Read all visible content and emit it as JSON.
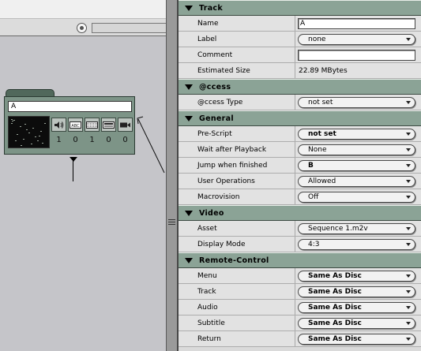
{
  "canvas": {
    "track_tile": {
      "name": "A",
      "stream_buttons": [
        {
          "icon": "speaker-icon",
          "count": "1"
        },
        {
          "icon": "abc-subtitle-icon",
          "count": "0"
        },
        {
          "icon": "menu-grid-icon",
          "count": "1"
        },
        {
          "icon": "marker-icon",
          "count": "0"
        },
        {
          "icon": "video-camera-icon",
          "count": "0"
        }
      ]
    }
  },
  "inspector": {
    "sections": [
      {
        "title": "Track",
        "rows": [
          {
            "label": "Name",
            "type": "text",
            "value": "A"
          },
          {
            "label": "Label",
            "type": "popup",
            "value": "none",
            "bold": false
          },
          {
            "label": "Comment",
            "type": "text",
            "value": ""
          },
          {
            "label": "Estimated Size",
            "type": "static",
            "value": "22.89 MBytes"
          }
        ]
      },
      {
        "title": "@ccess",
        "rows": [
          {
            "label": "@ccess Type",
            "type": "popup",
            "value": "not set",
            "bold": false
          }
        ]
      },
      {
        "title": "General",
        "rows": [
          {
            "label": "Pre-Script",
            "type": "popup",
            "value": "not set",
            "bold": true
          },
          {
            "label": "Wait after Playback",
            "type": "popup",
            "value": "None",
            "bold": false
          },
          {
            "label": "Jump when finished",
            "type": "popup",
            "value": "B",
            "bold": true
          },
          {
            "label": "User Operations",
            "type": "popup",
            "value": "Allowed",
            "bold": false
          },
          {
            "label": "Macrovision",
            "type": "popup",
            "value": "Off",
            "bold": false
          }
        ]
      },
      {
        "title": "Video",
        "rows": [
          {
            "label": "Asset",
            "type": "popup",
            "value": "Sequence 1.m2v",
            "bold": false
          },
          {
            "label": "Display Mode",
            "type": "popup",
            "value": "4:3",
            "bold": false
          }
        ]
      },
      {
        "title": "Remote-Control",
        "rows": [
          {
            "label": "Menu",
            "type": "popup",
            "value": "Same As Disc",
            "bold": true
          },
          {
            "label": "Track",
            "type": "popup",
            "value": "Same As Disc",
            "bold": true
          },
          {
            "label": "Audio",
            "type": "popup",
            "value": "Same As Disc",
            "bold": true
          },
          {
            "label": "Subtitle",
            "type": "popup",
            "value": "Same As Disc",
            "bold": true
          },
          {
            "label": "Return",
            "type": "popup",
            "value": "Same As Disc",
            "bold": true
          }
        ]
      }
    ]
  },
  "colors": {
    "section_header": "#8ba396",
    "tile_body": "#7d9487",
    "canvas_bg": "#c5c5c9"
  }
}
